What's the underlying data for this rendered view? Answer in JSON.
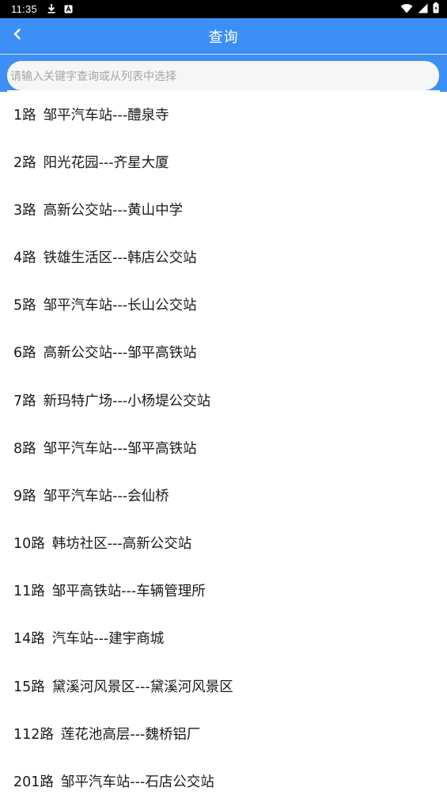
{
  "status_bar": {
    "time": "11:35",
    "icons": [
      "download-icon",
      "notification-app-icon",
      "wifi-icon",
      "signal-icon",
      "battery-icon"
    ]
  },
  "app_bar": {
    "title": "查询",
    "back_icon": "chevron-left-icon",
    "color": "#3d8ff5"
  },
  "search": {
    "placeholder": "请输入关键字查询或从列表中选择",
    "value": ""
  },
  "routes": [
    {
      "name": "1路",
      "stops": "邹平汽车站---醴泉寺"
    },
    {
      "name": "2路",
      "stops": "阳光花园---齐星大厦"
    },
    {
      "name": "3路",
      "stops": "高新公交站---黄山中学"
    },
    {
      "name": "4路",
      "stops": "铁雄生活区---韩店公交站"
    },
    {
      "name": "5路",
      "stops": "邹平汽车站---长山公交站"
    },
    {
      "name": "6路",
      "stops": "高新公交站---邹平高铁站"
    },
    {
      "name": "7路",
      "stops": "新玛特广场---小杨堤公交站"
    },
    {
      "name": "8路",
      "stops": "邹平汽车站---邹平高铁站"
    },
    {
      "name": "9路",
      "stops": "邹平汽车站---会仙桥"
    },
    {
      "name": "10路",
      "stops": "韩坊社区---高新公交站"
    },
    {
      "name": "11路",
      "stops": "邹平高铁站---车辆管理所"
    },
    {
      "name": "14路",
      "stops": "汽车站---建宇商城"
    },
    {
      "name": "15路",
      "stops": "黛溪河风景区---黛溪河风景区"
    },
    {
      "name": "112路",
      "stops": "莲花池高层---魏桥铝厂"
    },
    {
      "name": "201路",
      "stops": "邹平汽车站---石店公交站"
    }
  ]
}
